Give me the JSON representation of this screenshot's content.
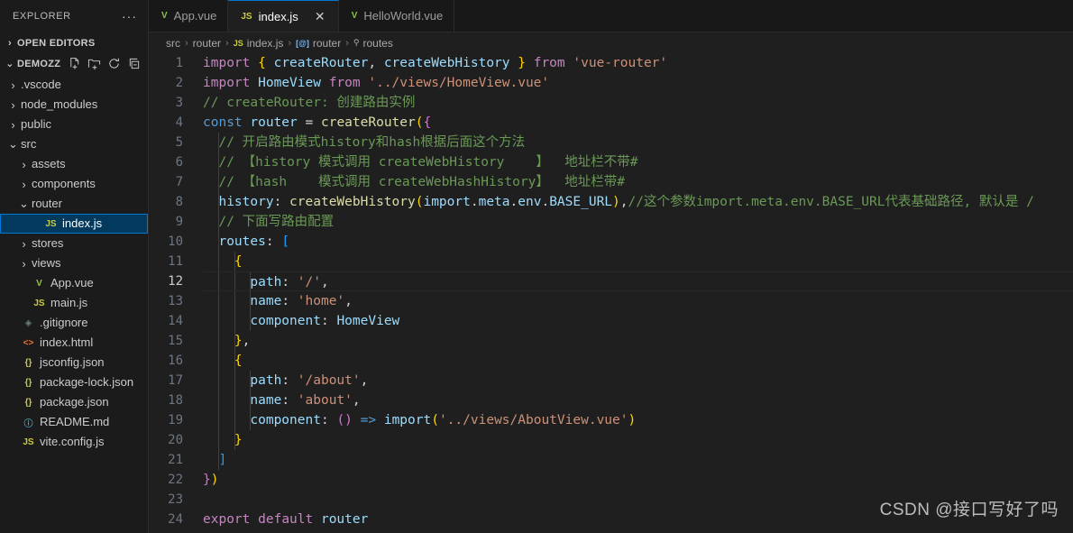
{
  "sidebar": {
    "title": "EXPLORER",
    "more_label": "···",
    "open_editors": {
      "label": "OPEN EDITORS",
      "twist": "›"
    },
    "workspace": {
      "label": "DEMOZZ",
      "twist": "⌄",
      "actions": [
        {
          "name": "new-file-icon",
          "glyph": "🗋"
        },
        {
          "name": "new-folder-icon",
          "glyph": "🗀"
        },
        {
          "name": "refresh-icon",
          "glyph": "⟳"
        },
        {
          "name": "collapse-all-icon",
          "glyph": "⊟"
        }
      ]
    },
    "items": [
      {
        "label": ".vscode",
        "indent": 1,
        "twist": "›",
        "icon": "",
        "icon_class": "",
        "selected": false
      },
      {
        "label": "node_modules",
        "indent": 1,
        "twist": "›",
        "icon": "",
        "icon_class": "",
        "selected": false
      },
      {
        "label": "public",
        "indent": 1,
        "twist": "›",
        "icon": "",
        "icon_class": "",
        "selected": false
      },
      {
        "label": "src",
        "indent": 1,
        "twist": "⌄",
        "icon": "",
        "icon_class": "",
        "selected": false
      },
      {
        "label": "assets",
        "indent": 2,
        "twist": "›",
        "icon": "",
        "icon_class": "",
        "selected": false
      },
      {
        "label": "components",
        "indent": 2,
        "twist": "›",
        "icon": "",
        "icon_class": "",
        "selected": false
      },
      {
        "label": "router",
        "indent": 2,
        "twist": "⌄",
        "icon": "",
        "icon_class": "",
        "selected": false
      },
      {
        "label": "index.js",
        "indent": 3,
        "twist": "",
        "icon": "JS",
        "icon_class": "ic-js",
        "selected": true
      },
      {
        "label": "stores",
        "indent": 2,
        "twist": "›",
        "icon": "",
        "icon_class": "",
        "selected": false
      },
      {
        "label": "views",
        "indent": 2,
        "twist": "›",
        "icon": "",
        "icon_class": "",
        "selected": false
      },
      {
        "label": "App.vue",
        "indent": 2,
        "twist": "",
        "icon": "V",
        "icon_class": "ic-vue",
        "selected": false
      },
      {
        "label": "main.js",
        "indent": 2,
        "twist": "",
        "icon": "JS",
        "icon_class": "ic-js",
        "selected": false
      },
      {
        "label": ".gitignore",
        "indent": 1,
        "twist": "",
        "icon": "◈",
        "icon_class": "ic-git",
        "selected": false
      },
      {
        "label": "index.html",
        "indent": 1,
        "twist": "",
        "icon": "<>",
        "icon_class": "ic-html",
        "selected": false
      },
      {
        "label": "jsconfig.json",
        "indent": 1,
        "twist": "",
        "icon": "{}",
        "icon_class": "ic-json",
        "selected": false
      },
      {
        "label": "package-lock.json",
        "indent": 1,
        "twist": "",
        "icon": "{}",
        "icon_class": "ic-json",
        "selected": false
      },
      {
        "label": "package.json",
        "indent": 1,
        "twist": "",
        "icon": "{}",
        "icon_class": "ic-json",
        "selected": false
      },
      {
        "label": "README.md",
        "indent": 1,
        "twist": "",
        "icon": "ⓘ",
        "icon_class": "ic-md",
        "selected": false
      },
      {
        "label": "vite.config.js",
        "indent": 1,
        "twist": "",
        "icon": "JS",
        "icon_class": "ic-js",
        "selected": false
      }
    ]
  },
  "tabs": [
    {
      "label": "App.vue",
      "icon": "V",
      "icon_class": "ic-vue",
      "active": false,
      "close": ""
    },
    {
      "label": "index.js",
      "icon": "JS",
      "icon_class": "ic-js",
      "active": true,
      "close": "✕"
    },
    {
      "label": "HelloWorld.vue",
      "icon": "V",
      "icon_class": "ic-vue",
      "active": false,
      "close": ""
    }
  ],
  "breadcrumb": [
    {
      "label": "src",
      "icon": "",
      "icon_class": ""
    },
    {
      "label": "router",
      "icon": "",
      "icon_class": ""
    },
    {
      "label": "index.js",
      "icon": "JS",
      "icon_class": "ic-js"
    },
    {
      "label": "router",
      "icon": "[@]",
      "icon_class": "ic-var"
    },
    {
      "label": "routes",
      "icon": "⚲",
      "icon_class": "ic-prop"
    }
  ],
  "breadcrumb_separator": "›",
  "editor": {
    "current_line": 12,
    "lines": [
      {
        "n": 1,
        "tokens": [
          {
            "c": "t-key",
            "s": "import"
          },
          {
            "c": "t-plain",
            "s": " "
          },
          {
            "c": "t-punc",
            "s": "{"
          },
          {
            "c": "t-plain",
            "s": " "
          },
          {
            "c": "t-var",
            "s": "createRouter"
          },
          {
            "c": "t-plain",
            "s": ", "
          },
          {
            "c": "t-var",
            "s": "createWebHistory"
          },
          {
            "c": "t-plain",
            "s": " "
          },
          {
            "c": "t-punc",
            "s": "}"
          },
          {
            "c": "t-plain",
            "s": " "
          },
          {
            "c": "t-key",
            "s": "from"
          },
          {
            "c": "t-plain",
            "s": " "
          },
          {
            "c": "t-str",
            "s": "'vue-router'"
          }
        ]
      },
      {
        "n": 2,
        "tokens": [
          {
            "c": "t-key",
            "s": "import"
          },
          {
            "c": "t-plain",
            "s": " "
          },
          {
            "c": "t-var",
            "s": "HomeView"
          },
          {
            "c": "t-plain",
            "s": " "
          },
          {
            "c": "t-key",
            "s": "from"
          },
          {
            "c": "t-plain",
            "s": " "
          },
          {
            "c": "t-str",
            "s": "'../views/HomeView.vue'"
          }
        ]
      },
      {
        "n": 3,
        "tokens": [
          {
            "c": "t-cmt",
            "s": "// createRouter: 创建路由实例"
          }
        ]
      },
      {
        "n": 4,
        "tokens": [
          {
            "c": "t-kw2",
            "s": "const"
          },
          {
            "c": "t-plain",
            "s": " "
          },
          {
            "c": "t-var",
            "s": "router"
          },
          {
            "c": "t-plain",
            "s": " = "
          },
          {
            "c": "t-fn",
            "s": "createRouter"
          },
          {
            "c": "t-punc",
            "s": "("
          },
          {
            "c": "t-punc2",
            "s": "{"
          }
        ]
      },
      {
        "n": 5,
        "tokens": [
          {
            "c": "t-plain",
            "s": "  "
          },
          {
            "c": "t-cmt",
            "s": "// 开启路由模式history和hash根据后面这个方法"
          }
        ]
      },
      {
        "n": 6,
        "tokens": [
          {
            "c": "t-plain",
            "s": "  "
          },
          {
            "c": "t-cmt",
            "s": "// 【history 模式调用 createWebHistory    】  地址栏不带#"
          }
        ]
      },
      {
        "n": 7,
        "tokens": [
          {
            "c": "t-plain",
            "s": "  "
          },
          {
            "c": "t-cmt",
            "s": "// 【hash    模式调用 createWebHashHistory】  地址栏带#"
          }
        ]
      },
      {
        "n": 8,
        "tokens": [
          {
            "c": "t-plain",
            "s": "  "
          },
          {
            "c": "t-var",
            "s": "history"
          },
          {
            "c": "t-plain",
            "s": ": "
          },
          {
            "c": "t-fn",
            "s": "createWebHistory"
          },
          {
            "c": "t-punc",
            "s": "("
          },
          {
            "c": "t-var",
            "s": "import"
          },
          {
            "c": "t-plain",
            "s": "."
          },
          {
            "c": "t-var",
            "s": "meta"
          },
          {
            "c": "t-plain",
            "s": "."
          },
          {
            "c": "t-var",
            "s": "env"
          },
          {
            "c": "t-plain",
            "s": "."
          },
          {
            "c": "t-var",
            "s": "BASE_URL"
          },
          {
            "c": "t-punc",
            "s": ")"
          },
          {
            "c": "t-plain",
            "s": ","
          },
          {
            "c": "t-cmt",
            "s": "//这个参数import.meta.env.BASE_URL代表基础路径, 默认是 /"
          }
        ]
      },
      {
        "n": 9,
        "tokens": [
          {
            "c": "t-plain",
            "s": "  "
          },
          {
            "c": "t-cmt",
            "s": "// 下面写路由配置"
          }
        ]
      },
      {
        "n": 10,
        "tokens": [
          {
            "c": "t-plain",
            "s": "  "
          },
          {
            "c": "t-var",
            "s": "routes"
          },
          {
            "c": "t-plain",
            "s": ": "
          },
          {
            "c": "t-punc3",
            "s": "["
          }
        ]
      },
      {
        "n": 11,
        "tokens": [
          {
            "c": "t-plain",
            "s": "    "
          },
          {
            "c": "t-punc",
            "s": "{"
          }
        ]
      },
      {
        "n": 12,
        "tokens": [
          {
            "c": "t-plain",
            "s": "      "
          },
          {
            "c": "t-var",
            "s": "path"
          },
          {
            "c": "t-plain",
            "s": ": "
          },
          {
            "c": "t-str",
            "s": "'/'"
          },
          {
            "c": "t-plain",
            "s": ","
          }
        ]
      },
      {
        "n": 13,
        "tokens": [
          {
            "c": "t-plain",
            "s": "      "
          },
          {
            "c": "t-var",
            "s": "name"
          },
          {
            "c": "t-plain",
            "s": ": "
          },
          {
            "c": "t-str",
            "s": "'home'"
          },
          {
            "c": "t-plain",
            "s": ","
          }
        ]
      },
      {
        "n": 14,
        "tokens": [
          {
            "c": "t-plain",
            "s": "      "
          },
          {
            "c": "t-var",
            "s": "component"
          },
          {
            "c": "t-plain",
            "s": ": "
          },
          {
            "c": "t-var",
            "s": "HomeView"
          }
        ]
      },
      {
        "n": 15,
        "tokens": [
          {
            "c": "t-plain",
            "s": "    "
          },
          {
            "c": "t-punc",
            "s": "}"
          },
          {
            "c": "t-plain",
            "s": ","
          }
        ]
      },
      {
        "n": 16,
        "tokens": [
          {
            "c": "t-plain",
            "s": "    "
          },
          {
            "c": "t-punc",
            "s": "{"
          }
        ]
      },
      {
        "n": 17,
        "tokens": [
          {
            "c": "t-plain",
            "s": "      "
          },
          {
            "c": "t-var",
            "s": "path"
          },
          {
            "c": "t-plain",
            "s": ": "
          },
          {
            "c": "t-str",
            "s": "'/about'"
          },
          {
            "c": "t-plain",
            "s": ","
          }
        ]
      },
      {
        "n": 18,
        "tokens": [
          {
            "c": "t-plain",
            "s": "      "
          },
          {
            "c": "t-var",
            "s": "name"
          },
          {
            "c": "t-plain",
            "s": ": "
          },
          {
            "c": "t-str",
            "s": "'about'"
          },
          {
            "c": "t-plain",
            "s": ","
          }
        ]
      },
      {
        "n": 19,
        "tokens": [
          {
            "c": "t-plain",
            "s": "      "
          },
          {
            "c": "t-var",
            "s": "component"
          },
          {
            "c": "t-plain",
            "s": ": "
          },
          {
            "c": "t-punc2",
            "s": "()"
          },
          {
            "c": "t-plain",
            "s": " "
          },
          {
            "c": "t-arrow",
            "s": "=>"
          },
          {
            "c": "t-plain",
            "s": " "
          },
          {
            "c": "t-var",
            "s": "import"
          },
          {
            "c": "t-punc",
            "s": "("
          },
          {
            "c": "t-str",
            "s": "'../views/AboutView.vue'"
          },
          {
            "c": "t-punc",
            "s": ")"
          }
        ]
      },
      {
        "n": 20,
        "tokens": [
          {
            "c": "t-plain",
            "s": "    "
          },
          {
            "c": "t-punc",
            "s": "}"
          }
        ]
      },
      {
        "n": 21,
        "tokens": [
          {
            "c": "t-plain",
            "s": "  "
          },
          {
            "c": "t-punc3",
            "s": "]"
          }
        ]
      },
      {
        "n": 22,
        "tokens": [
          {
            "c": "t-punc2",
            "s": "}"
          },
          {
            "c": "t-punc",
            "s": ")"
          }
        ]
      },
      {
        "n": 23,
        "tokens": []
      },
      {
        "n": 24,
        "tokens": [
          {
            "c": "t-key",
            "s": "export"
          },
          {
            "c": "t-plain",
            "s": " "
          },
          {
            "c": "t-key",
            "s": "default"
          },
          {
            "c": "t-plain",
            "s": " "
          },
          {
            "c": "t-var",
            "s": "router"
          }
        ]
      }
    ],
    "indent_guides": [
      {
        "line": 5,
        "cols": [
          1
        ]
      },
      {
        "line": 6,
        "cols": [
          1
        ]
      },
      {
        "line": 7,
        "cols": [
          1
        ]
      },
      {
        "line": 8,
        "cols": [
          1
        ]
      },
      {
        "line": 9,
        "cols": [
          1
        ]
      },
      {
        "line": 10,
        "cols": [
          1
        ]
      },
      {
        "line": 11,
        "cols": [
          1,
          2
        ]
      },
      {
        "line": 12,
        "cols": [
          1,
          2,
          3
        ]
      },
      {
        "line": 13,
        "cols": [
          1,
          2,
          3
        ]
      },
      {
        "line": 14,
        "cols": [
          1,
          2,
          3
        ]
      },
      {
        "line": 15,
        "cols": [
          1,
          2
        ]
      },
      {
        "line": 16,
        "cols": [
          1,
          2
        ]
      },
      {
        "line": 17,
        "cols": [
          1,
          2,
          3
        ]
      },
      {
        "line": 18,
        "cols": [
          1,
          2,
          3
        ]
      },
      {
        "line": 19,
        "cols": [
          1,
          2,
          3
        ]
      },
      {
        "line": 20,
        "cols": [
          1,
          2
        ]
      },
      {
        "line": 21,
        "cols": [
          1
        ]
      }
    ]
  },
  "watermark": "CSDN @接口写好了吗",
  "colors": {
    "accent": "#0078d4",
    "sidebar_bg": "#1b1b1b",
    "editor_bg": "#1f1f1f",
    "tabbar_bg": "#181818",
    "selection_bg": "#04395e"
  }
}
